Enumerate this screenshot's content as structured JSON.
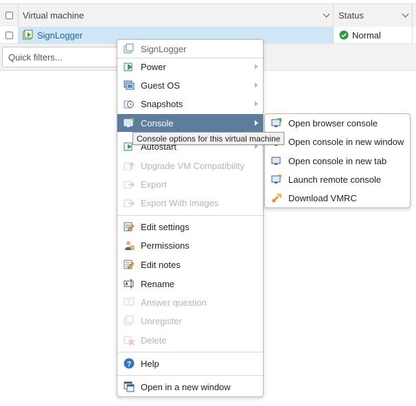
{
  "grid": {
    "columns": [
      {
        "label": "Virtual machine"
      },
      {
        "label": "Status"
      }
    ],
    "rows": [
      {
        "name": "SignLogger",
        "status": "Normal",
        "icon": "vm-powered-on-icon",
        "status_icon": "check-circle-icon"
      }
    ],
    "quick_filters_placeholder": "Quick filters..."
  },
  "context_menu": {
    "header": "SignLogger",
    "items": [
      {
        "label": "Power",
        "icon": "power-icon",
        "submenu": true,
        "enabled": true
      },
      {
        "label": "Guest OS",
        "icon": "guest-os-icon",
        "submenu": true,
        "enabled": true
      },
      {
        "label": "Snapshots",
        "icon": "snapshots-icon",
        "submenu": true,
        "enabled": true
      },
      {
        "label": "Console",
        "icon": "console-icon",
        "submenu": true,
        "enabled": true,
        "active": true
      },
      {
        "label": "Autostart",
        "icon": "autostart-icon",
        "submenu": true,
        "enabled": true
      },
      {
        "label": "Upgrade VM Compatibility",
        "icon": "upgrade-icon",
        "enabled": false
      },
      {
        "label": "Export",
        "icon": "export-icon",
        "enabled": false
      },
      {
        "label": "Export With Images",
        "icon": "export-images-icon",
        "enabled": false
      },
      {
        "label": "Edit settings",
        "icon": "edit-settings-icon",
        "enabled": true
      },
      {
        "label": "Permissions",
        "icon": "permissions-icon",
        "enabled": true
      },
      {
        "label": "Edit notes",
        "icon": "edit-notes-icon",
        "enabled": true
      },
      {
        "label": "Rename",
        "icon": "rename-icon",
        "enabled": true
      },
      {
        "label": "Answer question",
        "icon": "answer-question-icon",
        "enabled": false
      },
      {
        "label": "Unregister",
        "icon": "unregister-icon",
        "enabled": false
      },
      {
        "label": "Delete",
        "icon": "delete-icon",
        "enabled": false
      },
      {
        "label": "Help",
        "icon": "help-icon",
        "enabled": true
      },
      {
        "label": "Open in a new window",
        "icon": "new-window-icon",
        "enabled": true
      }
    ]
  },
  "console_submenu": {
    "items": [
      {
        "label": "Open browser console",
        "icon": "browser-console-icon"
      },
      {
        "label": "Open console in new window",
        "icon": "console-window-icon"
      },
      {
        "label": "Open console in new tab",
        "icon": "console-tab-icon"
      },
      {
        "label": "Launch remote console",
        "icon": "remote-console-icon"
      },
      {
        "label": "Download VMRC",
        "icon": "download-vmrc-icon"
      }
    ]
  },
  "tooltip": "Console options for this virtual machine",
  "colors": {
    "selected_row": "#cfe6f7",
    "menu_active": "#5d7d9c",
    "link": "#1e63a8",
    "status_ok": "#2e9a3e"
  }
}
